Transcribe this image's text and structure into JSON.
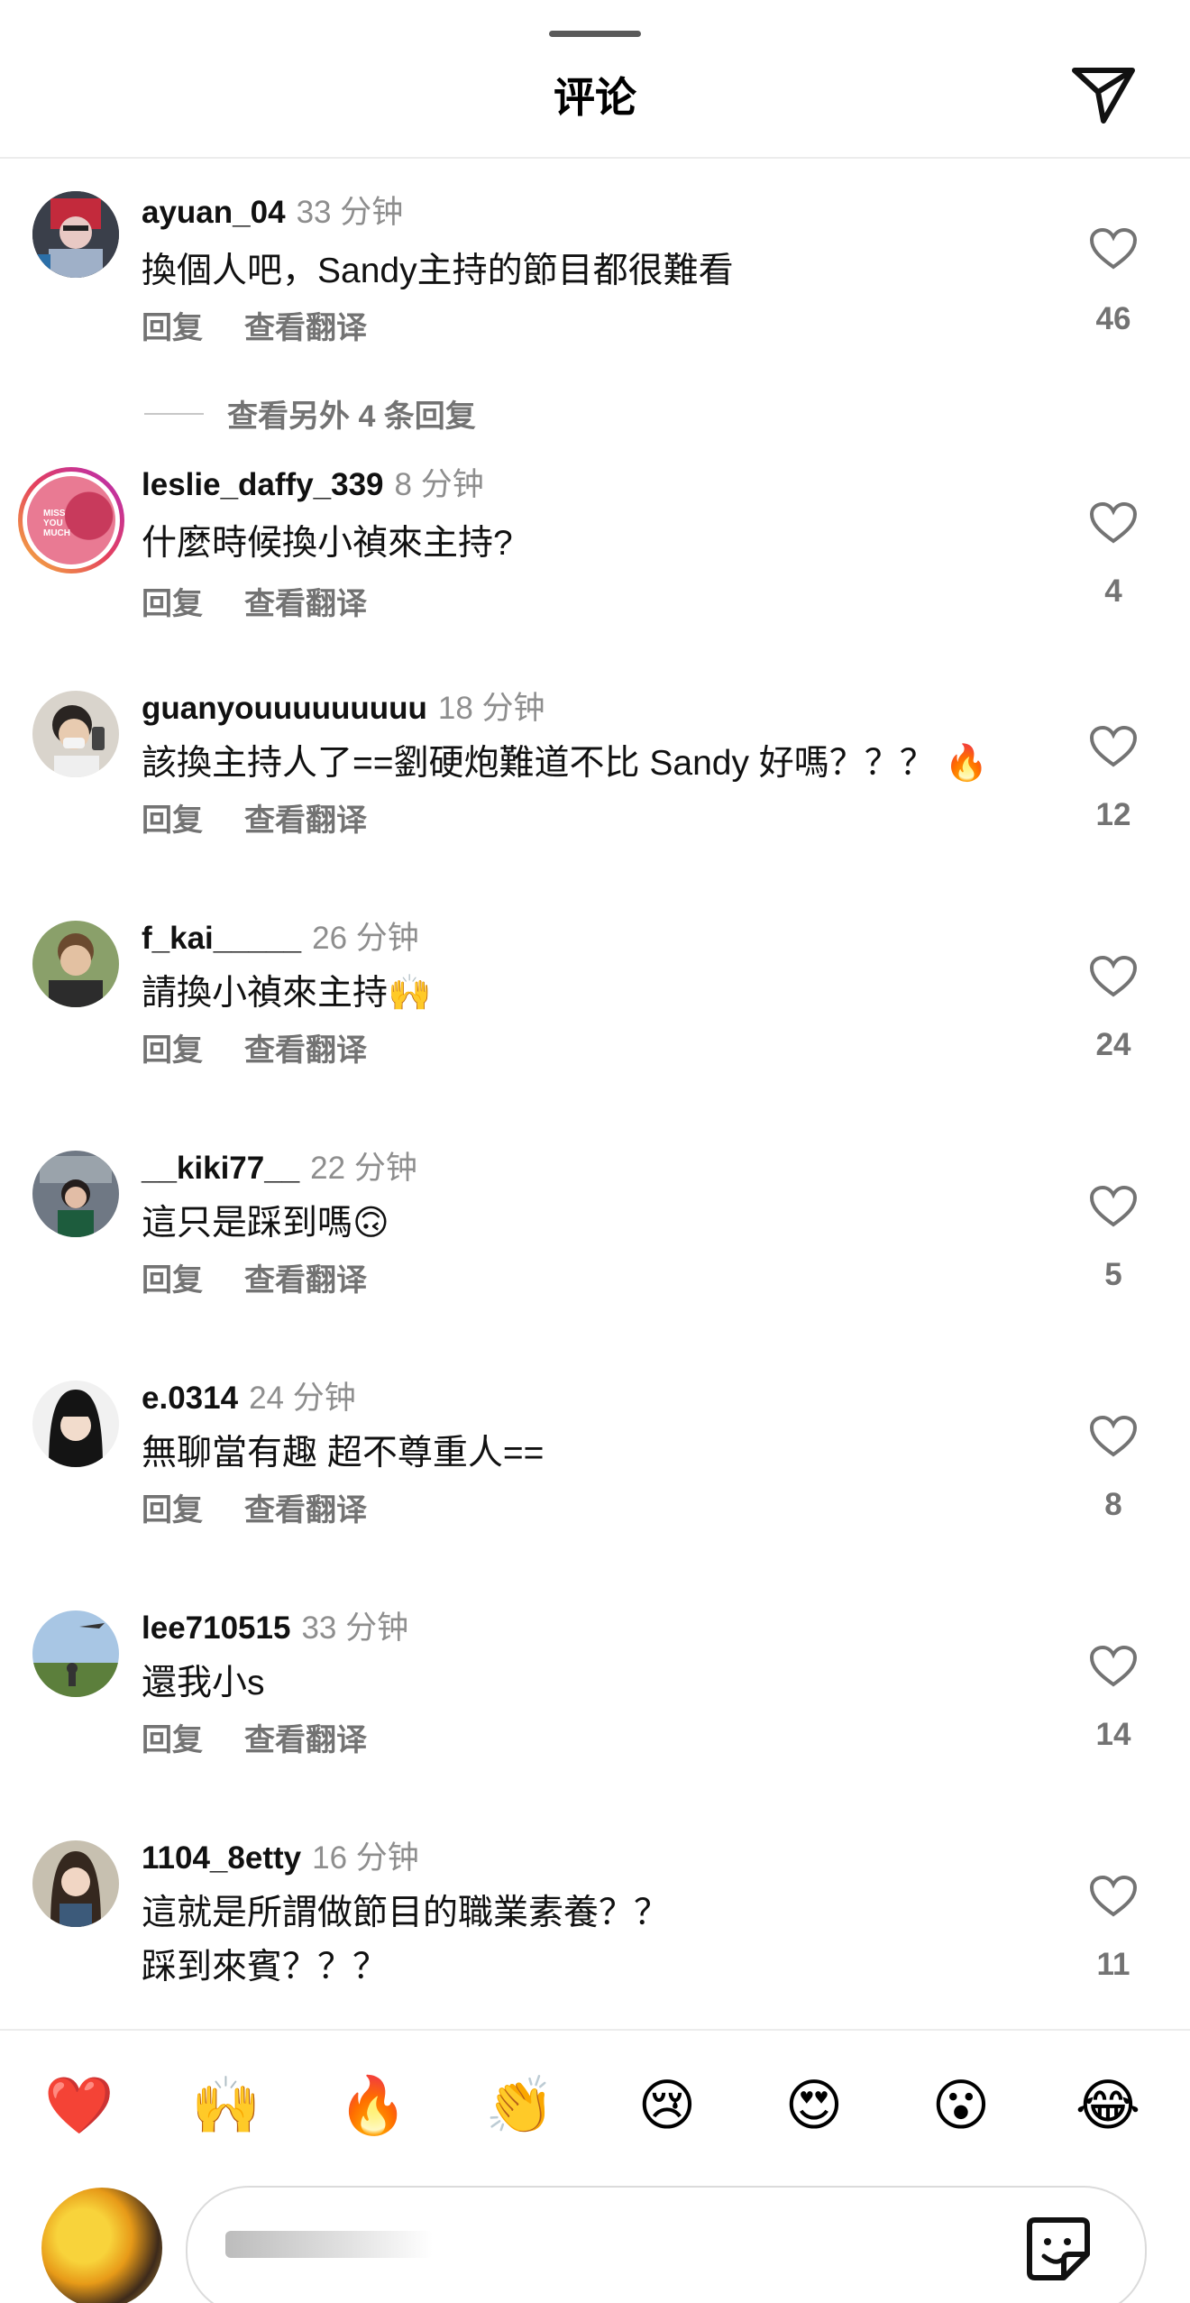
{
  "header": {
    "title": "评论"
  },
  "comments": [
    {
      "username": "ayuan_04",
      "time": "33 分钟",
      "text": "換個人吧，Sandy主持的節目都很難看",
      "reply": "回复",
      "translate": "查看翻译",
      "likes": "46",
      "more_replies": "查看另外 4 条回复"
    },
    {
      "username": "leslie_daffy_339",
      "time": "8 分钟",
      "text": "什麼時候換小禎來主持?",
      "reply": "回复",
      "translate": "查看翻译",
      "likes": "4",
      "avatar_text": "MISS YOU MUCH"
    },
    {
      "username": "guanyouuuuuuuuu",
      "time": "18 分钟",
      "text": "該換主持人了==劉硬炮難道不比 Sandy 好嗎？？？ 🔥",
      "reply": "回复",
      "translate": "查看翻译",
      "likes": "12"
    },
    {
      "username": "f_kai_____",
      "time": "26 分钟",
      "text": "請換小禎來主持🙌",
      "reply": "回复",
      "translate": "查看翻译",
      "likes": "24"
    },
    {
      "username": "__kiki77__",
      "time": "22 分钟",
      "text": "這只是踩到嗎🙃",
      "reply": "回复",
      "translate": "查看翻译",
      "likes": "5"
    },
    {
      "username": "e.0314",
      "time": "24 分钟",
      "text": "無聊當有趣 超不尊重人==",
      "reply": "回复",
      "translate": "查看翻译",
      "likes": "8"
    },
    {
      "username": "lee710515",
      "time": "33 分钟",
      "text": "還我小s",
      "reply": "回复",
      "translate": "查看翻译",
      "likes": "14"
    },
    {
      "username": "1104_8etty",
      "time": "16 分钟",
      "text": "這就是所謂做節目的職業素養？？",
      "text2": "踩到來賓？？？",
      "likes": "11"
    }
  ],
  "emoji_bar": [
    "❤️",
    "🙌",
    "🔥",
    "👏",
    "😢",
    "😍",
    "😮",
    "😂"
  ],
  "composer": {
    "value": "",
    "placeholder": ""
  },
  "icons": {
    "send": "send-icon",
    "heart": "heart-outline-icon",
    "sticker": "sticker-icon"
  }
}
